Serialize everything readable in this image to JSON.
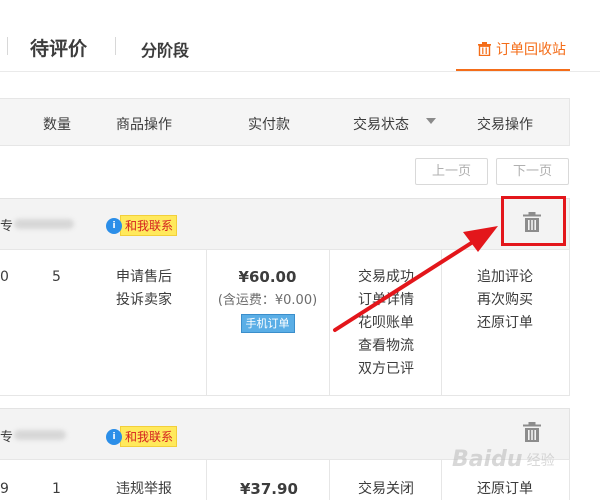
{
  "tabs": {
    "pending_review": "待评价",
    "stage": "分阶段",
    "recycle_bin": "订单回收站"
  },
  "table_header": {
    "quantity": "数量",
    "item_actions": "商品操作",
    "paid": "实付款",
    "trade_status": "交易状态",
    "trade_actions": "交易操作"
  },
  "pager": {
    "prev": "上一页",
    "next": "下一页"
  },
  "orders": [
    {
      "shop_fragment": "专",
      "contact": "和我联系",
      "left_fragment": "0",
      "quantity": "5",
      "item_actions": [
        "申请售后",
        "投诉卖家"
      ],
      "price": "¥60.00",
      "shipping": "(含运费：¥0.00)",
      "mobile_badge": "手机订单",
      "status": [
        "交易成功",
        "订单详情",
        "花呗账单",
        "查看物流",
        "双方已评"
      ],
      "actions": [
        "追加评论",
        "再次购买",
        "还原订单"
      ]
    },
    {
      "shop_fragment": "专",
      "contact": "和我联系",
      "left_fragment": "9",
      "quantity": "1",
      "item_actions": [
        "违规举报"
      ],
      "price": "¥37.90",
      "status": [
        "交易关闭"
      ],
      "actions": [
        "还原订单"
      ]
    }
  ],
  "watermark": {
    "brand": "Baidu",
    "sub": "经验"
  },
  "colors": {
    "accent": "#f46d19",
    "highlight": "#e3161b",
    "contact_bg": "#ffe95c"
  }
}
